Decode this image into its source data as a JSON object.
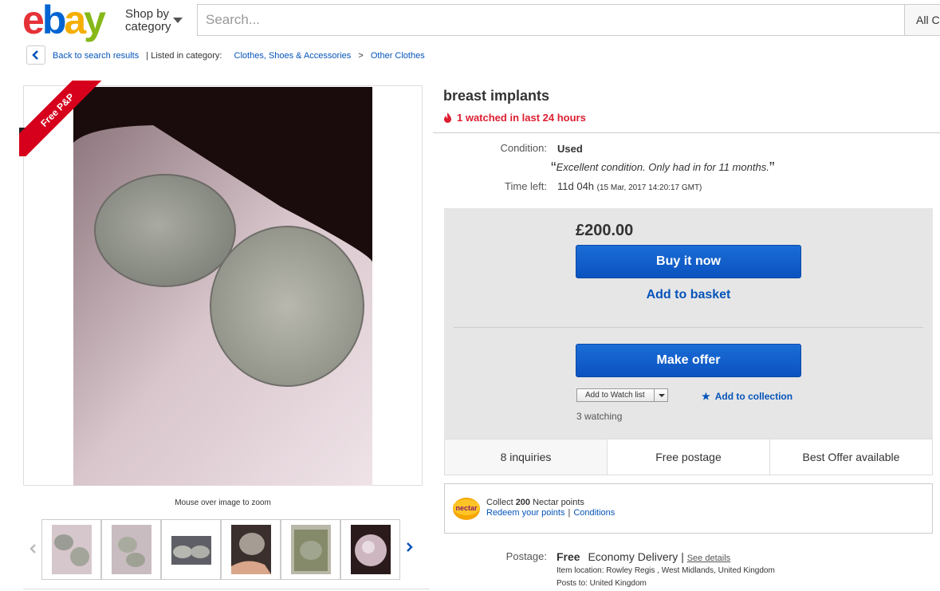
{
  "header": {
    "logo_letters": [
      "e",
      "b",
      "a",
      "y"
    ],
    "shop_by_label_1": "Shop by",
    "shop_by_label_2": "category",
    "search_placeholder": "Search...",
    "all_categories_label": "All Ca"
  },
  "breadcrumb": {
    "back_label": "Back to search results",
    "listed_in": "| Listed in category:",
    "category": "Clothes, Shoes & Accessories",
    "separator": ">",
    "subcategory": "Other Clothes"
  },
  "gallery": {
    "ribbon_text": "Free P&P",
    "zoom_hint": "Mouse over image to zoom",
    "thumbnail_count": 6
  },
  "listing": {
    "title": "breast implants",
    "watched_text": "1 watched in last 24 hours",
    "condition_label": "Condition:",
    "condition_value": "Used",
    "seller_note_open": "“",
    "seller_note": "Excellent condition. Only had in for 11 months.",
    "seller_note_close": "”",
    "time_left_label": "Time left:",
    "time_left_value": "11d 04h",
    "time_left_end": "(15 Mar, 2017   14:20:17 GMT)"
  },
  "buy_box": {
    "price": "£200.00",
    "buy_now_label": "Buy it now",
    "add_to_basket_label": "Add to basket",
    "make_offer_label": "Make offer",
    "watch_list_label": "Add to Watch list",
    "add_collection_label": "Add to collection",
    "watching_count": "3 watching"
  },
  "stats": [
    "8 inquiries",
    "Free postage",
    "Best Offer available"
  ],
  "nectar": {
    "logo_text": "nectar",
    "collect_prefix": "Collect",
    "points": "200",
    "collect_suffix": "Nectar points",
    "redeem_label": "Redeem your points",
    "separator": "|",
    "conditions_label": "Conditions"
  },
  "postage": {
    "label": "Postage:",
    "cost": "Free",
    "method": "Economy Delivery",
    "separator": "|",
    "see_details": "See details",
    "item_location": "Item location:  Rowley Regis , West Midlands, United Kingdom",
    "posts_to": "Posts to:  United Kingdom"
  },
  "colors": {
    "ebay_red": "#e53238",
    "ebay_blue": "#0064d2",
    "ebay_yellow": "#f5af02",
    "ebay_green": "#86b817",
    "link_blue": "#0654ba",
    "alert_red": "#dd1e31",
    "button_blue": "#0a52bf",
    "ribbon_red": "#d6001c"
  }
}
